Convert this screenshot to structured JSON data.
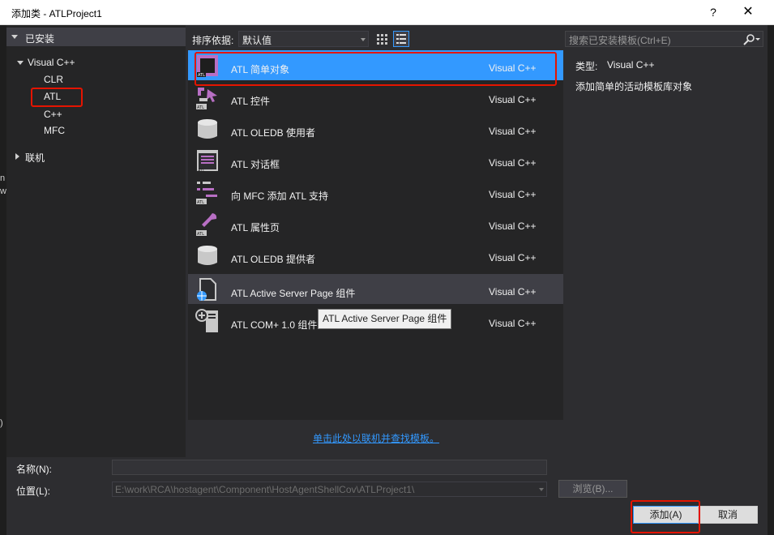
{
  "window": {
    "title": "添加类 - ATLProject1",
    "help_label": "?",
    "close_label": "✕"
  },
  "sidebar": {
    "installed_label": "已安装",
    "group_label": "Visual C++",
    "items": [
      {
        "label": "CLR"
      },
      {
        "label": "ATL"
      },
      {
        "label": "C++"
      },
      {
        "label": "MFC"
      }
    ],
    "online_label": "联机"
  },
  "toolbar": {
    "sort_label": "排序依据:",
    "sort_value": "默认值",
    "search_placeholder": "搜索已安装模板(Ctrl+E)"
  },
  "templates": [
    {
      "name": "ATL 简单对象",
      "language": "Visual C++",
      "icon": "atl-simple-object-icon",
      "selected": true
    },
    {
      "name": "ATL 控件",
      "language": "Visual C++",
      "icon": "atl-control-icon"
    },
    {
      "name": "ATL OLEDB 使用者",
      "language": "Visual C++",
      "icon": "database-icon"
    },
    {
      "name": "ATL 对话框",
      "language": "Visual C++",
      "icon": "atl-dialog-icon"
    },
    {
      "name": "向 MFC 添加 ATL 支持",
      "language": "Visual C++",
      "icon": "atl-list-icon"
    },
    {
      "name": "ATL 属性页",
      "language": "Visual C++",
      "icon": "atl-property-page-icon"
    },
    {
      "name": "ATL OLEDB 提供者",
      "language": "Visual C++",
      "icon": "database-icon"
    },
    {
      "name": "ATL Active Server Page 组件",
      "language": "Visual C++",
      "icon": "asp-page-icon",
      "hover": true
    },
    {
      "name": "ATL COM+ 1.0 组件",
      "language": "Visual C++",
      "icon": "com-plus-icon"
    }
  ],
  "tooltip": "ATL Active Server Page 组件",
  "online_link": "单击此处以联机并查找模板。",
  "details": {
    "type_label": "类型:",
    "type_value": "Visual C++",
    "description": "添加简单的活动模板库对象"
  },
  "form": {
    "name_label": "名称(N):",
    "name_value": "",
    "location_label": "位置(L):",
    "location_value": "E:\\work\\RCA\\hostagent\\Component\\HostAgentShellCov\\ATLProject1\\",
    "browse_label": "浏览(B)...",
    "add_label": "添加(A)",
    "cancel_label": "取消"
  },
  "colors": {
    "accent": "#3399ff",
    "background": "#2d2d30",
    "panel": "#252526",
    "highlight_box": "#e51400",
    "atl_icon": "#b86fc4"
  }
}
